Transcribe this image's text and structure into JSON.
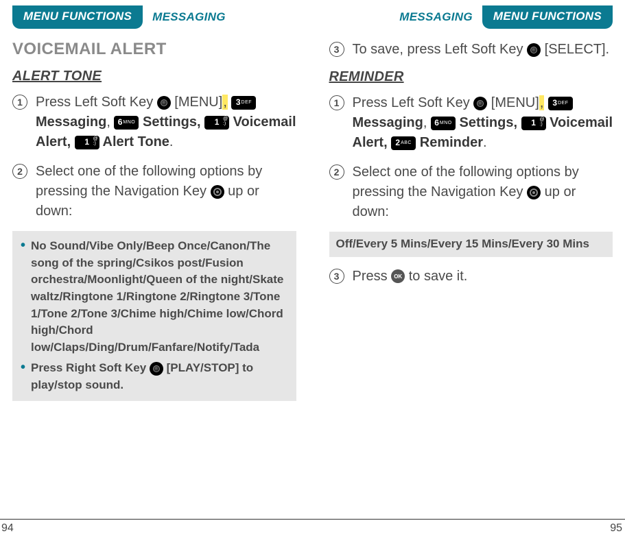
{
  "left": {
    "tab": "MENU FUNCTIONS",
    "crumb": "MESSAGING",
    "title": "VOICEMAIL ALERT",
    "subhead": "ALERT TONE",
    "step1_a": "Press Left Soft Key ",
    "step1_b": " [MENU]",
    "comma1": ",",
    "key3": "3",
    "key3sub": "DEF",
    "step1_c": " Messaging",
    "comma2": ", ",
    "key6": "6",
    "key6sub": "MNO",
    "step1_d": " Settings,",
    "key1": "1",
    "step1_e": " Voicemail Alert, ",
    "key1b": "1",
    "step1_f": " Alert Tone",
    "period1": ".",
    "step2_a": "Select one of the following options by pressing the Navigation Key ",
    "step2_b": " up or down:",
    "box1_item1": "No Sound/Vibe Only/Beep Once/Canon/The song of the spring/Csikos post/Fusion orchestra/Moonlight/Queen of the night/Skate waltz/Ringtone 1/Ringtone 2/Ringtone 3/Tone 1/Tone 2/Tone 3/Chime high/Chime low/Chord high/Chord low/Claps/Ding/Drum/Fanfare/Notify/Tada",
    "box1_item2a": "Press Right Soft Key ",
    "box1_item2b": " [PLAY/STOP] to play/stop sound.",
    "pagenum": "94"
  },
  "right": {
    "crumb": "MESSAGING",
    "tab": "MENU FUNCTIONS",
    "step3_a": "To save, press Left Soft Key ",
    "step3_b": " [SELECT].",
    "subhead": "REMINDER",
    "r1_a": "Press Left Soft Key ",
    "r1_b": " [MENU]",
    "r1_comma1": ",",
    "key3": "3",
    "key3sub": "DEF",
    "r1_c": " Messaging",
    "r1_comma2": ", ",
    "key6": "6",
    "key6sub": "MNO",
    "r1_d": " Settings,",
    "key1": "1",
    "r1_e": " Voicemail Alert, ",
    "key2": "2",
    "key2sub": "ABC",
    "r1_f": " Reminder",
    "period1": ".",
    "r2_a": "Select one of the following options by pressing the Navigation Key ",
    "r2_b": " up or down:",
    "box2": "Off/Every 5 Mins/Every 15 Mins/Every 30 Mins",
    "r3_a": "Press ",
    "r3_ok": "OK",
    "r3_b": " to save it.",
    "pagenum": "95"
  },
  "nums": {
    "n1": "1",
    "n2": "2",
    "n3": "3"
  }
}
